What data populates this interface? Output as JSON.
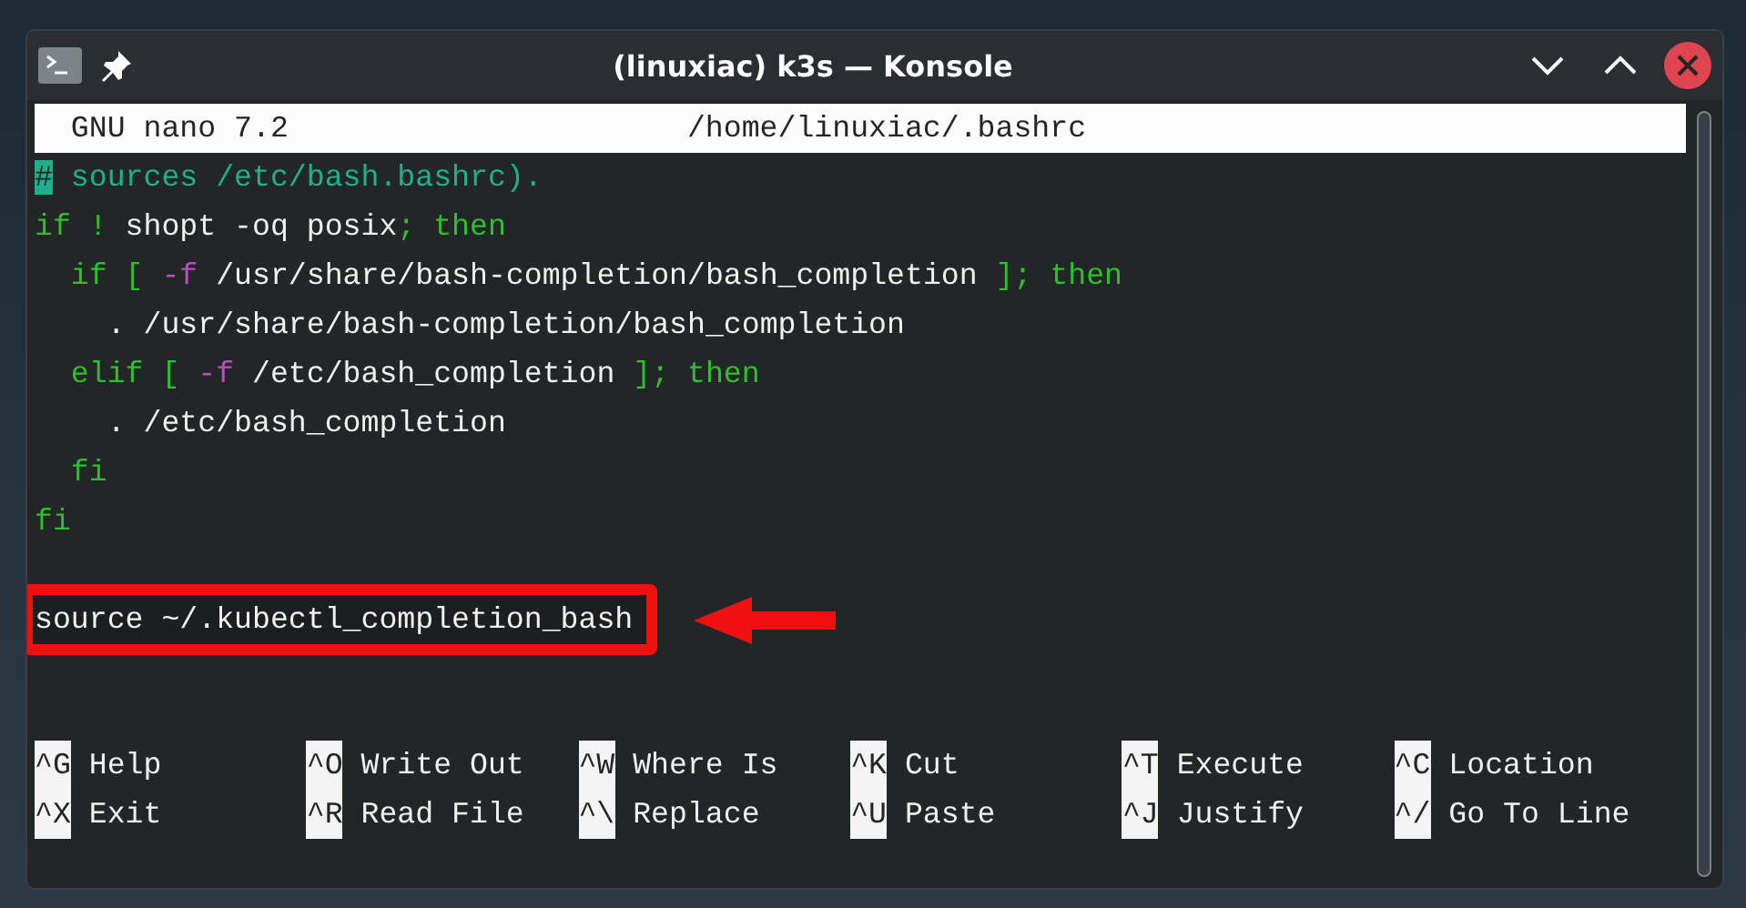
{
  "window": {
    "title": "(linuxiac) k3s — Konsole"
  },
  "nano": {
    "version": "GNU nano 7.2",
    "file": "/home/linuxiac/.bashrc"
  },
  "lines": [
    {
      "highlighted": false,
      "segments": [
        {
          "kind": "cursor",
          "text": "#"
        },
        {
          "kind": "comment",
          "text": " sources /etc/bash.bashrc)."
        }
      ]
    },
    {
      "highlighted": false,
      "segments": [
        {
          "kind": "keyword",
          "text": "if ! "
        },
        {
          "kind": "plain",
          "text": "shopt -oq posix"
        },
        {
          "kind": "keyword",
          "text": "; then"
        }
      ]
    },
    {
      "highlighted": false,
      "segments": [
        {
          "kind": "keyword",
          "text": "  if [ "
        },
        {
          "kind": "flag",
          "text": "-f"
        },
        {
          "kind": "plain",
          "text": " /usr/share/bash-completion/bash_completion "
        },
        {
          "kind": "keyword",
          "text": "]; then"
        }
      ]
    },
    {
      "highlighted": false,
      "segments": [
        {
          "kind": "plain",
          "text": "    . /usr/share/bash-completion/bash_completion"
        }
      ]
    },
    {
      "highlighted": false,
      "segments": [
        {
          "kind": "keyword",
          "text": "  elif [ "
        },
        {
          "kind": "flag",
          "text": "-f"
        },
        {
          "kind": "plain",
          "text": " /etc/bash_completion "
        },
        {
          "kind": "keyword",
          "text": "]; then"
        }
      ]
    },
    {
      "highlighted": false,
      "segments": [
        {
          "kind": "plain",
          "text": "    . /etc/bash_completion"
        }
      ]
    },
    {
      "highlighted": false,
      "segments": [
        {
          "kind": "keyword",
          "text": "  fi"
        }
      ]
    },
    {
      "highlighted": false,
      "segments": [
        {
          "kind": "keyword",
          "text": "fi"
        }
      ]
    },
    {
      "highlighted": false
    },
    {
      "highlighted": true,
      "segments": [
        {
          "kind": "plain",
          "text": "source ~/.kubectl_completion_bash"
        }
      ]
    }
  ],
  "shortcuts": [
    {
      "key": "^G",
      "label": "Help"
    },
    {
      "key": "^O",
      "label": "Write Out"
    },
    {
      "key": "^W",
      "label": "Where Is"
    },
    {
      "key": "^K",
      "label": "Cut"
    },
    {
      "key": "^T",
      "label": "Execute"
    },
    {
      "key": "^C",
      "label": "Location"
    },
    {
      "key": "^X",
      "label": "Exit"
    },
    {
      "key": "^R",
      "label": "Read File"
    },
    {
      "key": "^\\",
      "label": "Replace"
    },
    {
      "key": "^U",
      "label": "Paste"
    },
    {
      "key": "^J",
      "label": "Justify"
    },
    {
      "key": "^/",
      "label": "Go To Line"
    }
  ]
}
